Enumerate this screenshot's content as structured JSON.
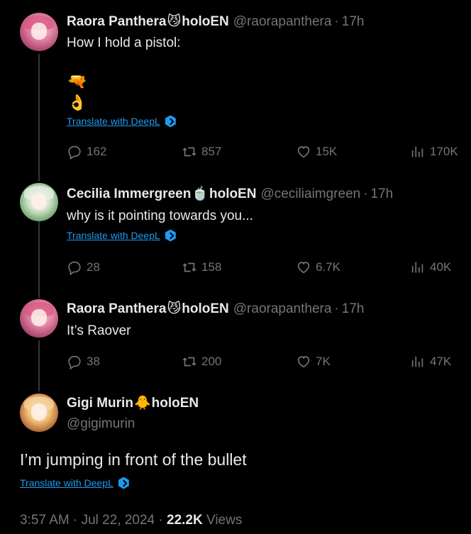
{
  "tweets": [
    {
      "display_name": "Raora Panthera",
      "emoji": "😼",
      "suffix": "holoEN",
      "handle": "@raorapanthera",
      "time": "17h",
      "text": "How I hold a pistol:",
      "emoji_lines": [
        "🔫",
        "👌"
      ],
      "translate": "Translate with DeepL",
      "replies": "162",
      "reposts": "857",
      "likes": "15K",
      "views": "170K"
    },
    {
      "display_name": "Cecilia Immergreen",
      "emoji": "🍵",
      "suffix": "holoEN",
      "handle": "@ceciliaimgreen",
      "time": "17h",
      "text": "why is it pointing towards you...",
      "translate": "Translate with DeepL",
      "replies": "28",
      "reposts": "158",
      "likes": "6.7K",
      "views": "40K"
    },
    {
      "display_name": "Raora Panthera",
      "emoji": "😼",
      "suffix": "holoEN",
      "handle": "@raorapanthera",
      "time": "17h",
      "text": "It’s Raover",
      "replies": "38",
      "reposts": "200",
      "likes": "7K",
      "views": "47K"
    }
  ],
  "main": {
    "display_name": "Gigi Murin",
    "emoji": "🐥",
    "suffix": "holoEN",
    "handle": "@gigimurin",
    "text": "I’m jumping in front of the bullet",
    "translate": "Translate with DeepL",
    "timestamp": "3:57 AM · Jul 22, 2024 ·",
    "views_count": "22.2K",
    "views_label": "Views"
  },
  "separator": "·",
  "icons": {
    "reply": "reply-icon",
    "repost": "repost-icon",
    "like": "heart-icon",
    "views": "views-icon",
    "deepl": "deepl-icon"
  }
}
